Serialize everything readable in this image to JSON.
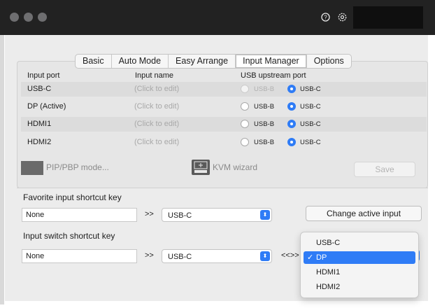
{
  "tabs": [
    {
      "label": "Basic",
      "active": false
    },
    {
      "label": "Auto Mode",
      "active": false
    },
    {
      "label": "Easy Arrange",
      "active": false
    },
    {
      "label": "Input Manager",
      "active": true
    },
    {
      "label": "Options",
      "active": false
    }
  ],
  "table": {
    "headers": {
      "port": "Input port",
      "name": "Input name",
      "usb": "USB upstream port"
    },
    "rows": [
      {
        "port": "USB-C",
        "name": "(Click to edit)",
        "usb_b": "USB-B",
        "usb_c": "USB-C",
        "selected": "USB-C",
        "usb_b_disabled": true
      },
      {
        "port": "DP (Active)",
        "name": "(Click to edit)",
        "usb_b": "USB-B",
        "usb_c": "USB-C",
        "selected": "USB-C",
        "usb_b_disabled": false
      },
      {
        "port": "HDMI1",
        "name": "(Click to edit)",
        "usb_b": "USB-B",
        "usb_c": "USB-C",
        "selected": "USB-C",
        "usb_b_disabled": false
      },
      {
        "port": "HDMI2",
        "name": "(Click to edit)",
        "usb_b": "USB-B",
        "usb_c": "USB-C",
        "selected": "USB-C",
        "usb_b_disabled": false
      }
    ]
  },
  "actions": {
    "pip_label": "PIP/PBP mode...",
    "kvm_label": "KVM wizard",
    "save_label": "Save"
  },
  "favorite": {
    "title": "Favorite input shortcut key",
    "key_value": "None",
    "arrow": ">>",
    "input_value": "USB-C",
    "button_label": "Change active input"
  },
  "switch": {
    "title": "Input switch shortcut key",
    "key_value": "None",
    "arrow": ">>",
    "input_value": "USB-C",
    "swap": "<<>>"
  },
  "dropdown": {
    "options": [
      "USB-C",
      "DP",
      "HDMI1",
      "HDMI2"
    ],
    "selected": "DP",
    "check": "✓"
  },
  "icons": {
    "help": "question-circle-icon",
    "settings": "gear-icon",
    "kvm": "kvm-wizard-icon"
  },
  "colors": {
    "accent": "#2f7cf6",
    "titlebar": "#222222",
    "window": "#ececec"
  }
}
